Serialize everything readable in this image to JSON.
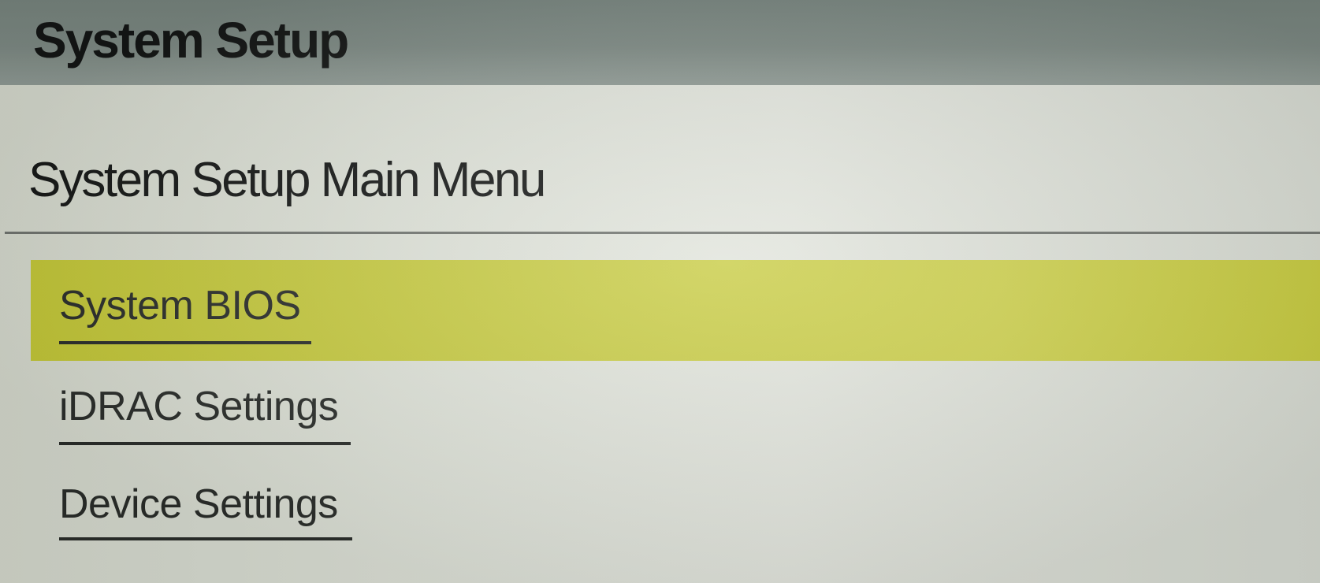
{
  "app": {
    "title": "System Setup"
  },
  "page": {
    "title": "System Setup Main Menu"
  },
  "menu": {
    "items": [
      {
        "label": "System BIOS",
        "selected": true
      },
      {
        "label": "iDRAC Settings",
        "selected": false
      },
      {
        "label": "Device Settings",
        "selected": false
      }
    ]
  },
  "colors": {
    "title_bar": "#7b8781",
    "background": "#dde1d7",
    "selection_highlight": "#c7cb45",
    "text": "#2a2d2a"
  }
}
